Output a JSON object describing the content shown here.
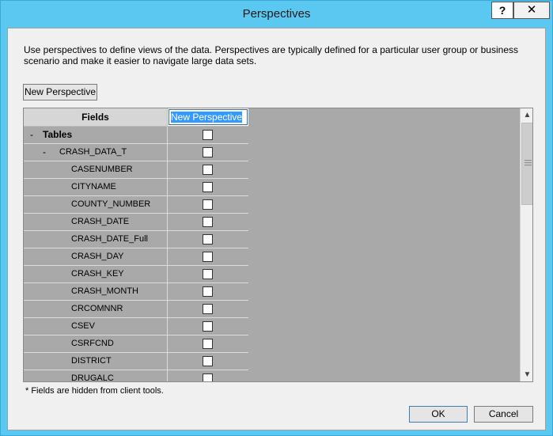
{
  "window": {
    "title": "Perspectives",
    "help_label": "?",
    "close_label": "✕"
  },
  "description": "Use perspectives to define views of the data. Perspectives are typically defined for a particular user group or business scenario and make it easier to navigate large data sets.",
  "toolbar": {
    "new_perspective_label": "New Perspective"
  },
  "grid": {
    "fields_header": "Fields",
    "perspective_name": "New Perspective",
    "rows": [
      {
        "expander": "-",
        "label": "Tables",
        "level": 0,
        "checked": false
      },
      {
        "expander": "-",
        "label": "CRASH_DATA_T",
        "level": 1,
        "checked": false
      },
      {
        "expander": "",
        "label": "CASENUMBER",
        "level": 2,
        "checked": false
      },
      {
        "expander": "",
        "label": "CITYNAME",
        "level": 2,
        "checked": false
      },
      {
        "expander": "",
        "label": "COUNTY_NUMBER",
        "level": 2,
        "checked": false
      },
      {
        "expander": "",
        "label": "CRASH_DATE",
        "level": 2,
        "checked": false
      },
      {
        "expander": "",
        "label": "CRASH_DATE_Full",
        "level": 2,
        "checked": false
      },
      {
        "expander": "",
        "label": "CRASH_DAY",
        "level": 2,
        "checked": false
      },
      {
        "expander": "",
        "label": "CRASH_KEY",
        "level": 2,
        "checked": false
      },
      {
        "expander": "",
        "label": "CRASH_MONTH",
        "level": 2,
        "checked": false
      },
      {
        "expander": "",
        "label": "CRCOMNNR",
        "level": 2,
        "checked": false
      },
      {
        "expander": "",
        "label": "CSEV",
        "level": 2,
        "checked": false
      },
      {
        "expander": "",
        "label": "CSRFCND",
        "level": 2,
        "checked": false
      },
      {
        "expander": "",
        "label": "DISTRICT",
        "level": 2,
        "checked": false
      },
      {
        "expander": "",
        "label": "DRUGALC",
        "level": 2,
        "checked": false
      }
    ]
  },
  "scrollbar": {
    "up_icon": "chevron-up-icon",
    "down_icon": "chevron-down-icon"
  },
  "footnote": "* Fields are hidden from client tools.",
  "buttons": {
    "ok_label": "OK",
    "cancel_label": "Cancel"
  },
  "colors": {
    "titlebar": "#5ac8f0",
    "selection": "#3399ff",
    "grid_empty": "#a9a9a9"
  }
}
